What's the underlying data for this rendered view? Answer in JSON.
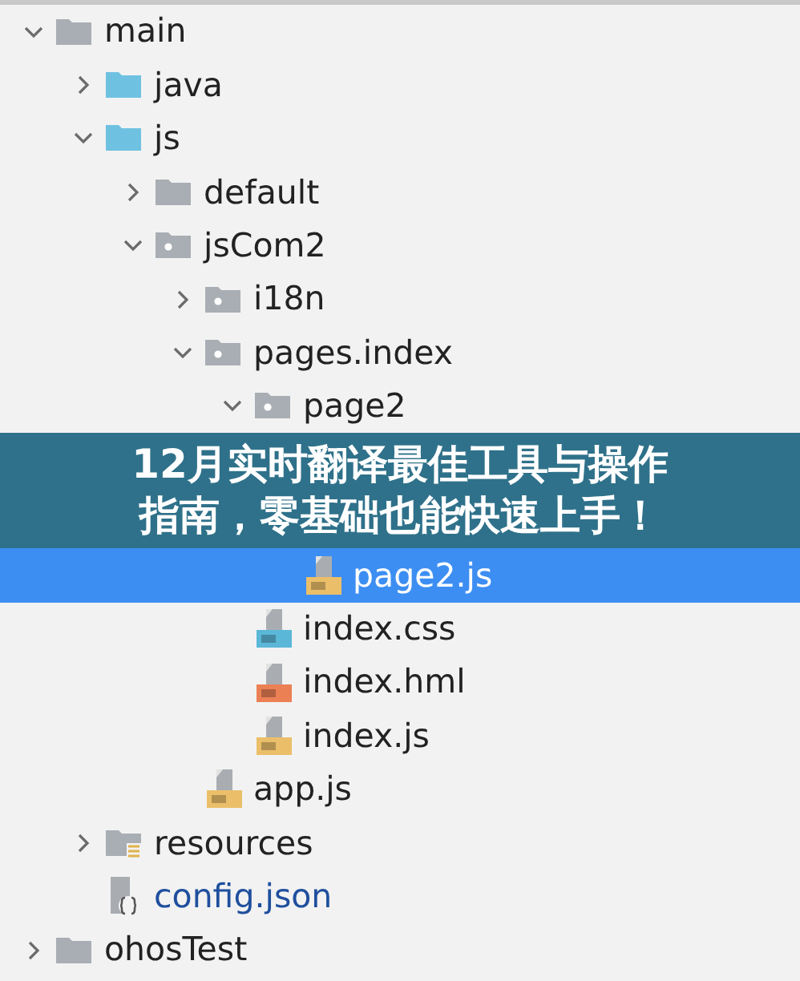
{
  "tree": [
    {
      "label": "main",
      "kind": "folder",
      "expanded": true,
      "selected": false,
      "children": [
        {
          "label": "java",
          "kind": "source-folder",
          "expanded": false,
          "selected": false
        },
        {
          "label": "js",
          "kind": "source-folder",
          "expanded": true,
          "selected": false,
          "children": [
            {
              "label": "default",
              "kind": "folder",
              "expanded": false,
              "selected": false
            },
            {
              "label": "jsCom2",
              "kind": "module-folder",
              "expanded": true,
              "selected": false,
              "children": [
                {
                  "label": "i18n",
                  "kind": "module-folder",
                  "expanded": false,
                  "selected": false
                },
                {
                  "label": "pages.index",
                  "kind": "module-folder",
                  "expanded": true,
                  "selected": false,
                  "children": [
                    {
                      "label": "page2",
                      "kind": "module-folder",
                      "expanded": true,
                      "selected": false,
                      "children": [
                        {
                          "label": "page2.js",
                          "kind": "js-file",
                          "selected": true
                        }
                      ]
                    },
                    {
                      "label": "index.css",
                      "kind": "css-file",
                      "selected": false
                    },
                    {
                      "label": "index.hml",
                      "kind": "hml-file",
                      "selected": false
                    },
                    {
                      "label": "index.js",
                      "kind": "js-file",
                      "selected": false
                    }
                  ]
                },
                {
                  "label": "app.js",
                  "kind": "js-file",
                  "selected": false
                }
              ]
            }
          ]
        },
        {
          "label": "resources",
          "kind": "resource-folder",
          "expanded": false,
          "selected": false
        },
        {
          "label": "config.json",
          "kind": "json-file",
          "selected": false
        }
      ]
    },
    {
      "label": "ohosTest",
      "kind": "folder",
      "expanded": false,
      "selected": false
    }
  ],
  "banner": {
    "lines": [
      "12月实时翻译最佳工具与操作",
      "指南，零基础也能快速上手！"
    ]
  }
}
